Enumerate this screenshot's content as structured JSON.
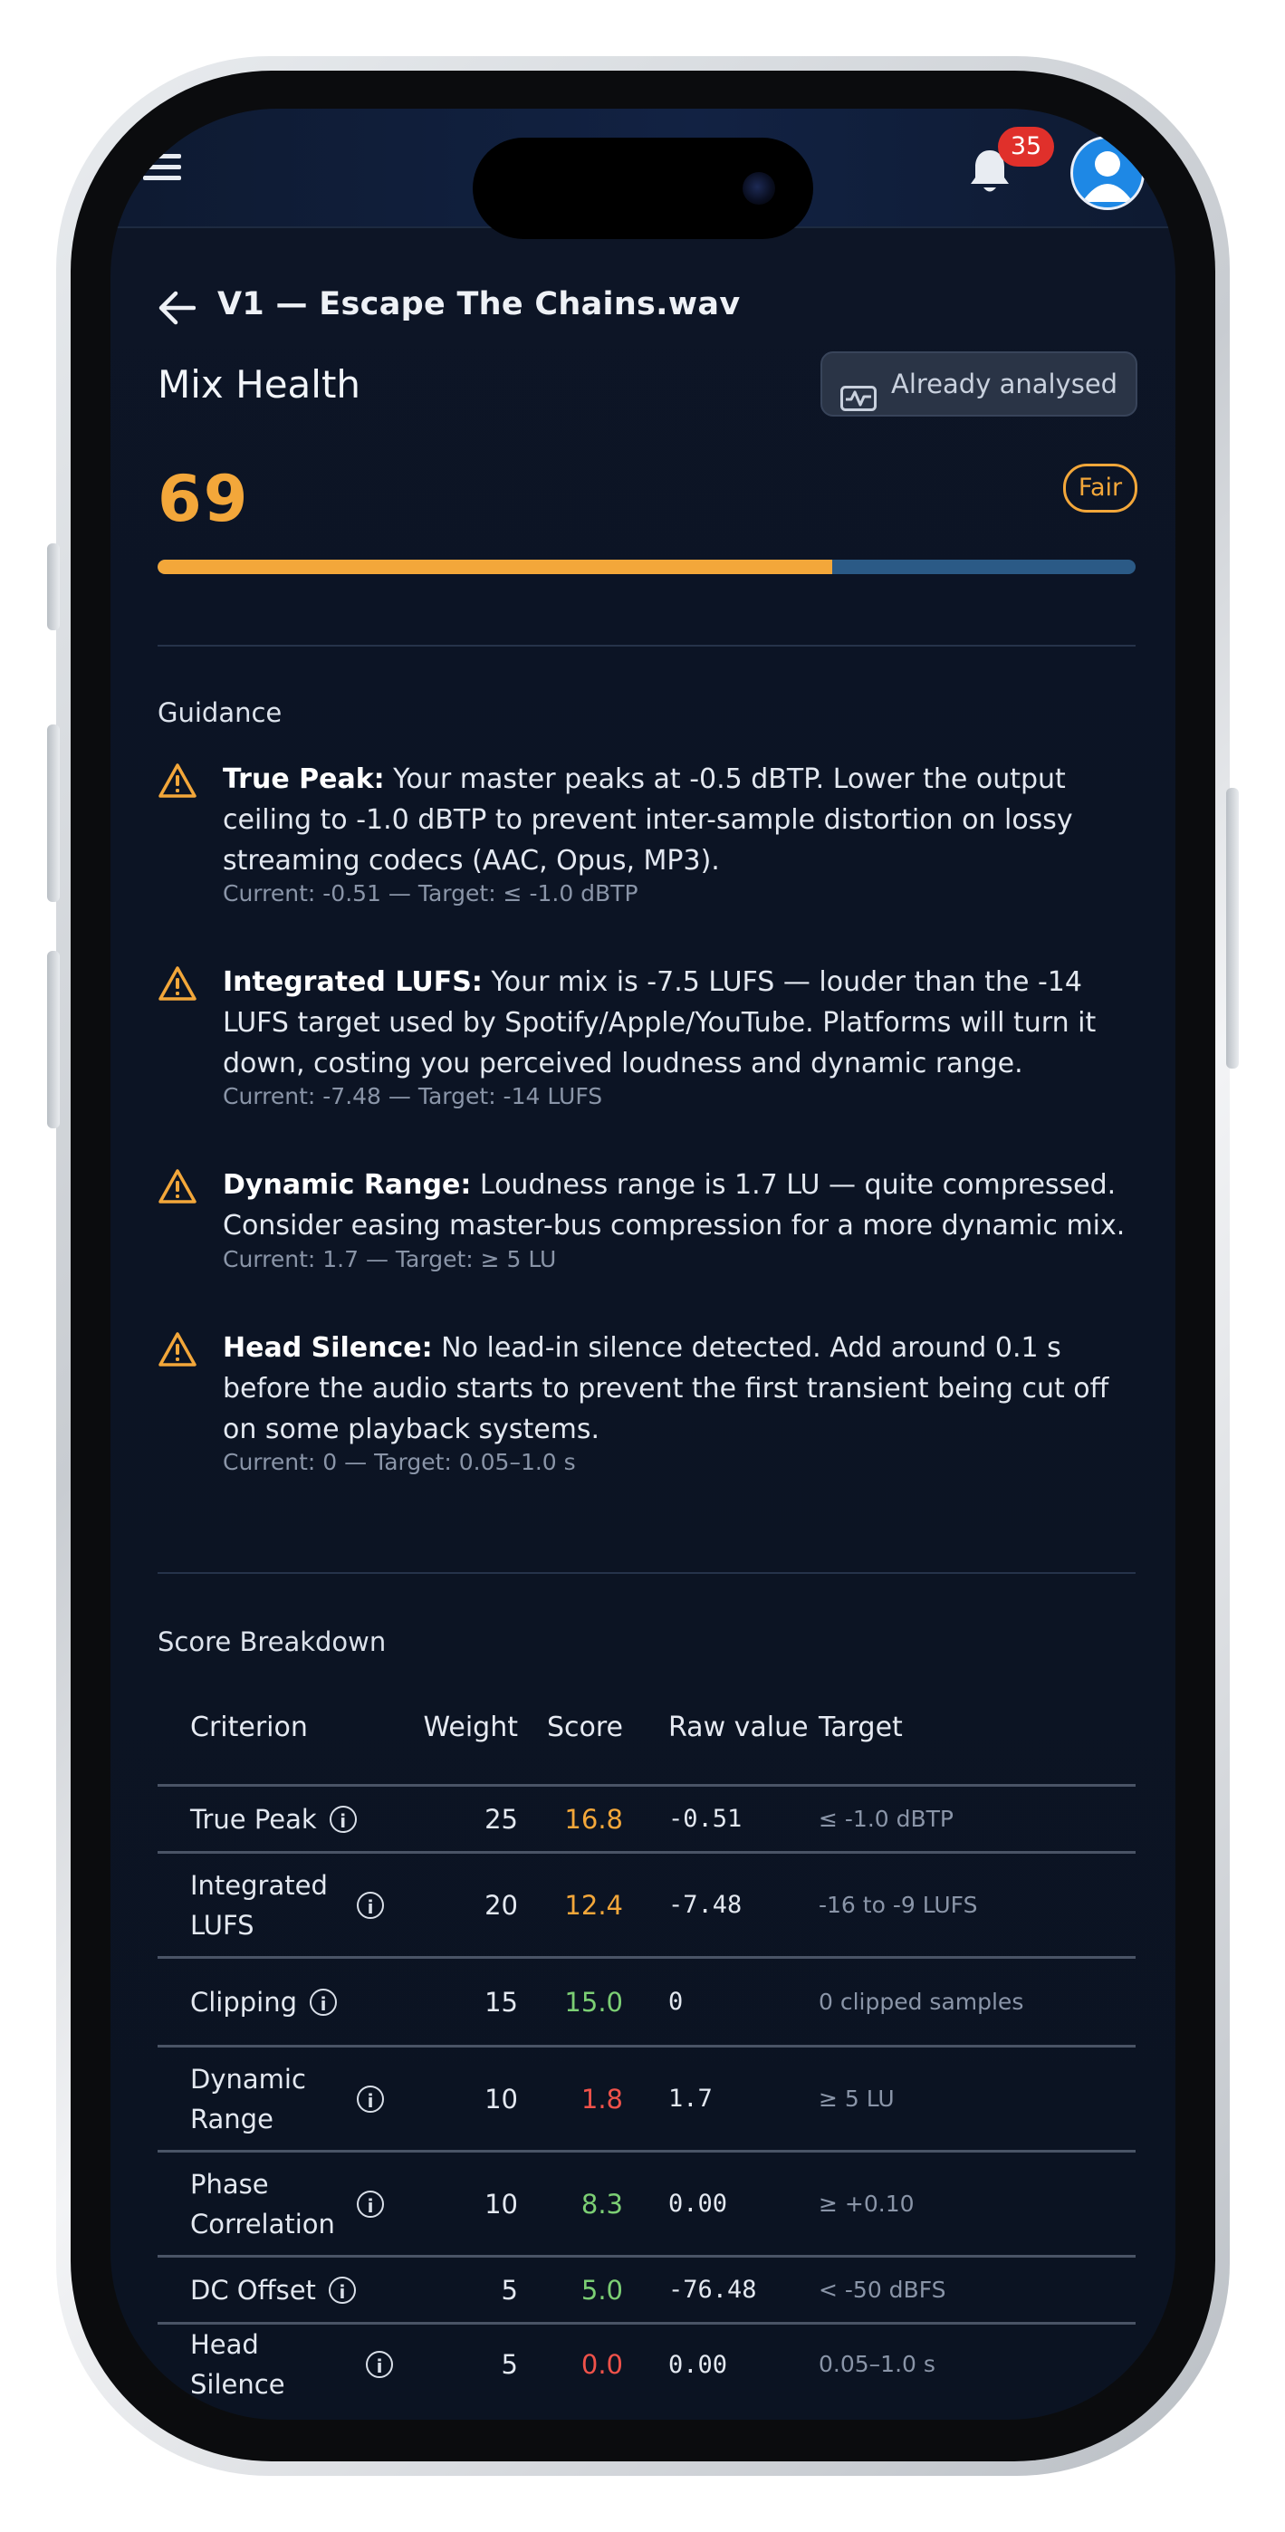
{
  "header": {
    "notification_count": "35"
  },
  "page": {
    "file_title": "V1 — Escape The Chains.wav",
    "section_title": "Mix Health",
    "analysed_label": "Already analysed",
    "score": "69",
    "grade": "Fair",
    "progress_fraction": 0.69
  },
  "guidance": {
    "title": "Guidance",
    "items": [
      {
        "label": "True Peak:",
        "text": " Your master peaks at -0.5 dBTP. Lower the output ceiling to -1.0 dBTP to prevent inter-sample distortion on lossy streaming codecs (AAC, Opus, MP3).",
        "meta": "Current: -0.51 — Target: ≤ -1.0 dBTP"
      },
      {
        "label": "Integrated LUFS:",
        "text": " Your mix is -7.5 LUFS — louder than the -14 LUFS target used by Spotify/Apple/YouTube. Platforms will turn it down, costing you perceived loudness and dynamic range.",
        "meta": "Current: -7.48 — Target: -14 LUFS"
      },
      {
        "label": "Dynamic Range:",
        "text": " Loudness range is 1.7 LU — quite compressed. Consider easing master-bus compression for a more dynamic mix.",
        "meta": "Current: 1.7 — Target: ≥ 5 LU"
      },
      {
        "label": "Head Silence:",
        "text": " No lead-in silence detected. Add around 0.1 s before the audio starts to prevent the first transient being cut off on some playback systems.",
        "meta": "Current: 0 — Target: 0.05–1.0 s"
      }
    ]
  },
  "breakdown": {
    "title": "Score Breakdown",
    "columns": {
      "criterion": "Criterion",
      "weight": "Weight",
      "score": "Score",
      "raw": "Raw value",
      "target": "Target"
    },
    "rows": [
      {
        "criterion": "True Peak",
        "weight": "25",
        "score": "16.8",
        "score_color": "#f3a73a",
        "raw": "-0.51",
        "target": "≤ -1.0 dBTP"
      },
      {
        "criterion": "Integrated LUFS",
        "weight": "20",
        "score": "12.4",
        "score_color": "#f3a73a",
        "raw": "-7.48",
        "target": "-16 to -9 LUFS"
      },
      {
        "criterion": "Clipping",
        "weight": "15",
        "score": "15.0",
        "score_color": "#7ccf74",
        "raw": "0",
        "target": "0 clipped samples"
      },
      {
        "criterion": "Dynamic Range",
        "weight": "10",
        "score": "1.8",
        "score_color": "#f0524a",
        "raw": "1.7",
        "target": "≥ 5 LU"
      },
      {
        "criterion": "Phase Correlation",
        "weight": "10",
        "score": "8.3",
        "score_color": "#7ccf74",
        "raw": "0.00",
        "target": "≥ +0.10"
      },
      {
        "criterion": "DC Offset",
        "weight": "5",
        "score": "5.0",
        "score_color": "#7ccf74",
        "raw": "-76.48",
        "target": "< -50 dBFS"
      },
      {
        "criterion": "Head Silence",
        "weight": "5",
        "score": "0.0",
        "score_color": "#f0524a",
        "raw": "0.00",
        "target": "0.05–1.0 s"
      }
    ]
  },
  "colors": {
    "accent": "#f3a73a",
    "good": "#7ccf74",
    "bad": "#f0524a",
    "badge": "#e0302b"
  },
  "icons": [
    "menu-icon",
    "bell-icon",
    "avatar-icon",
    "back-arrow-icon",
    "waveform-icon",
    "warning-icon",
    "info-icon"
  ]
}
